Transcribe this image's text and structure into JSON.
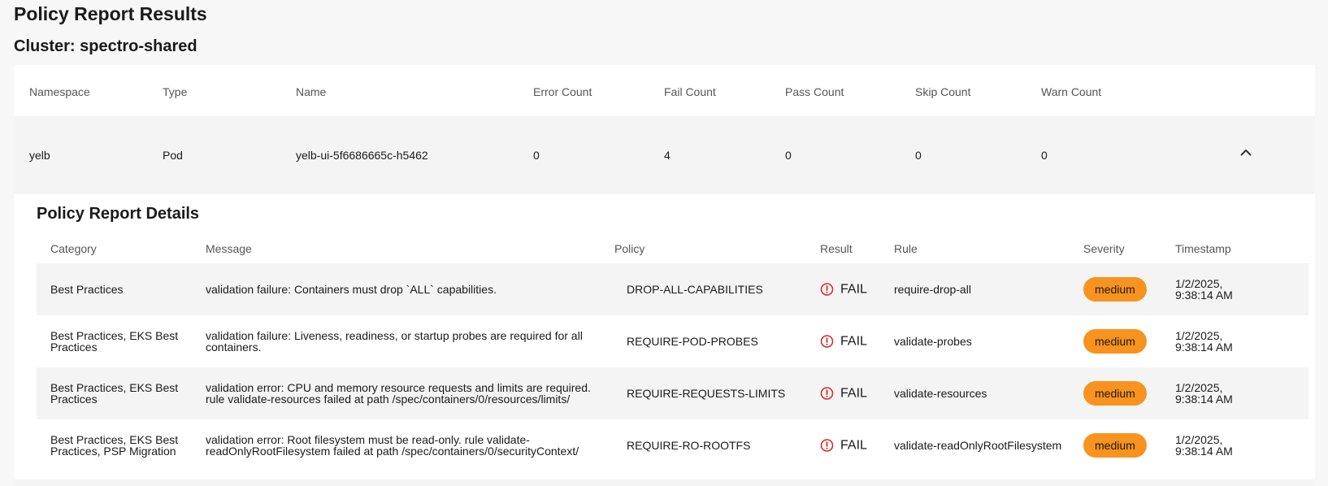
{
  "page": {
    "title": "Policy Report Results",
    "cluster_title": "Cluster: spectro-shared"
  },
  "summary": {
    "columns": [
      "Namespace",
      "Type",
      "Name",
      "Error Count",
      "Fail Count",
      "Pass Count",
      "Skip Count",
      "Warn Count"
    ],
    "row": {
      "namespace": "yelb",
      "type": "Pod",
      "name": "yelb-ui-5f6686665c-h5462",
      "error_count": "0",
      "fail_count": "4",
      "pass_count": "0",
      "skip_count": "0",
      "warn_count": "0",
      "expand_icon": "chevron-up-icon"
    }
  },
  "details": {
    "title": "Policy Report Details",
    "columns": [
      "Category",
      "Message",
      "Policy",
      "Result",
      "Rule",
      "Severity",
      "Timestamp"
    ],
    "rows": [
      {
        "category": [
          "Best Practices"
        ],
        "message": [
          "validation failure: Containers must drop `ALL` capabilities."
        ],
        "policy": "DROP-ALL-CAPABILITIES",
        "result": "FAIL",
        "rule": "require-drop-all",
        "severity": "medium",
        "timestamp": [
          "1/2/2025,",
          "9:38:14 AM"
        ]
      },
      {
        "category": [
          "Best Practices, EKS Best",
          "Practices"
        ],
        "message": [
          "validation failure: Liveness, readiness, or startup probes are required for all",
          "containers."
        ],
        "policy": "REQUIRE-POD-PROBES",
        "result": "FAIL",
        "rule": "validate-probes",
        "severity": "medium",
        "timestamp": [
          "1/2/2025,",
          "9:38:14 AM"
        ]
      },
      {
        "category": [
          "Best Practices, EKS Best",
          "Practices"
        ],
        "message": [
          "validation error: CPU and memory resource requests and limits are required.",
          "rule validate-resources failed at path /spec/containers/0/resources/limits/"
        ],
        "policy": "REQUIRE-REQUESTS-LIMITS",
        "result": "FAIL",
        "rule": "validate-resources",
        "severity": "medium",
        "timestamp": [
          "1/2/2025,",
          "9:38:14 AM"
        ]
      },
      {
        "category": [
          "Best Practices, EKS Best",
          "Practices, PSP Migration"
        ],
        "message": [
          "validation error: Root filesystem must be read-only. rule validate-",
          "readOnlyRootFilesystem failed at path /spec/containers/0/securityContext/"
        ],
        "policy": "REQUIRE-RO-ROOTFS",
        "result": "FAIL",
        "rule": "validate-readOnlyRootFilesystem",
        "severity": "medium",
        "timestamp": [
          "1/2/2025,",
          "9:38:14 AM"
        ]
      }
    ]
  },
  "colors": {
    "severity_medium": "#f7931e",
    "fail_icon": "#d32f2f",
    "row_shade": "#f4f4f4"
  },
  "icons": {
    "result_fail": "alert-circle-icon"
  }
}
